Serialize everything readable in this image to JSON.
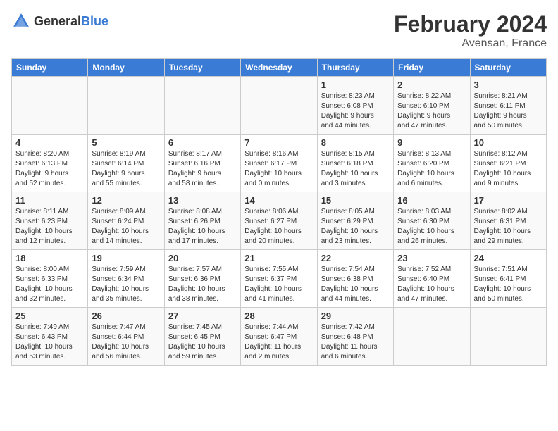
{
  "header": {
    "logo_general": "General",
    "logo_blue": "Blue",
    "month_year": "February 2024",
    "location": "Avensan, France"
  },
  "days_of_week": [
    "Sunday",
    "Monday",
    "Tuesday",
    "Wednesday",
    "Thursday",
    "Friday",
    "Saturday"
  ],
  "weeks": [
    [
      {
        "day": "",
        "info": ""
      },
      {
        "day": "",
        "info": ""
      },
      {
        "day": "",
        "info": ""
      },
      {
        "day": "",
        "info": ""
      },
      {
        "day": "1",
        "info": "Sunrise: 8:23 AM\nSunset: 6:08 PM\nDaylight: 9 hours\nand 44 minutes."
      },
      {
        "day": "2",
        "info": "Sunrise: 8:22 AM\nSunset: 6:10 PM\nDaylight: 9 hours\nand 47 minutes."
      },
      {
        "day": "3",
        "info": "Sunrise: 8:21 AM\nSunset: 6:11 PM\nDaylight: 9 hours\nand 50 minutes."
      }
    ],
    [
      {
        "day": "4",
        "info": "Sunrise: 8:20 AM\nSunset: 6:13 PM\nDaylight: 9 hours\nand 52 minutes."
      },
      {
        "day": "5",
        "info": "Sunrise: 8:19 AM\nSunset: 6:14 PM\nDaylight: 9 hours\nand 55 minutes."
      },
      {
        "day": "6",
        "info": "Sunrise: 8:17 AM\nSunset: 6:16 PM\nDaylight: 9 hours\nand 58 minutes."
      },
      {
        "day": "7",
        "info": "Sunrise: 8:16 AM\nSunset: 6:17 PM\nDaylight: 10 hours\nand 0 minutes."
      },
      {
        "day": "8",
        "info": "Sunrise: 8:15 AM\nSunset: 6:18 PM\nDaylight: 10 hours\nand 3 minutes."
      },
      {
        "day": "9",
        "info": "Sunrise: 8:13 AM\nSunset: 6:20 PM\nDaylight: 10 hours\nand 6 minutes."
      },
      {
        "day": "10",
        "info": "Sunrise: 8:12 AM\nSunset: 6:21 PM\nDaylight: 10 hours\nand 9 minutes."
      }
    ],
    [
      {
        "day": "11",
        "info": "Sunrise: 8:11 AM\nSunset: 6:23 PM\nDaylight: 10 hours\nand 12 minutes."
      },
      {
        "day": "12",
        "info": "Sunrise: 8:09 AM\nSunset: 6:24 PM\nDaylight: 10 hours\nand 14 minutes."
      },
      {
        "day": "13",
        "info": "Sunrise: 8:08 AM\nSunset: 6:26 PM\nDaylight: 10 hours\nand 17 minutes."
      },
      {
        "day": "14",
        "info": "Sunrise: 8:06 AM\nSunset: 6:27 PM\nDaylight: 10 hours\nand 20 minutes."
      },
      {
        "day": "15",
        "info": "Sunrise: 8:05 AM\nSunset: 6:29 PM\nDaylight: 10 hours\nand 23 minutes."
      },
      {
        "day": "16",
        "info": "Sunrise: 8:03 AM\nSunset: 6:30 PM\nDaylight: 10 hours\nand 26 minutes."
      },
      {
        "day": "17",
        "info": "Sunrise: 8:02 AM\nSunset: 6:31 PM\nDaylight: 10 hours\nand 29 minutes."
      }
    ],
    [
      {
        "day": "18",
        "info": "Sunrise: 8:00 AM\nSunset: 6:33 PM\nDaylight: 10 hours\nand 32 minutes."
      },
      {
        "day": "19",
        "info": "Sunrise: 7:59 AM\nSunset: 6:34 PM\nDaylight: 10 hours\nand 35 minutes."
      },
      {
        "day": "20",
        "info": "Sunrise: 7:57 AM\nSunset: 6:36 PM\nDaylight: 10 hours\nand 38 minutes."
      },
      {
        "day": "21",
        "info": "Sunrise: 7:55 AM\nSunset: 6:37 PM\nDaylight: 10 hours\nand 41 minutes."
      },
      {
        "day": "22",
        "info": "Sunrise: 7:54 AM\nSunset: 6:38 PM\nDaylight: 10 hours\nand 44 minutes."
      },
      {
        "day": "23",
        "info": "Sunrise: 7:52 AM\nSunset: 6:40 PM\nDaylight: 10 hours\nand 47 minutes."
      },
      {
        "day": "24",
        "info": "Sunrise: 7:51 AM\nSunset: 6:41 PM\nDaylight: 10 hours\nand 50 minutes."
      }
    ],
    [
      {
        "day": "25",
        "info": "Sunrise: 7:49 AM\nSunset: 6:43 PM\nDaylight: 10 hours\nand 53 minutes."
      },
      {
        "day": "26",
        "info": "Sunrise: 7:47 AM\nSunset: 6:44 PM\nDaylight: 10 hours\nand 56 minutes."
      },
      {
        "day": "27",
        "info": "Sunrise: 7:45 AM\nSunset: 6:45 PM\nDaylight: 10 hours\nand 59 minutes."
      },
      {
        "day": "28",
        "info": "Sunrise: 7:44 AM\nSunset: 6:47 PM\nDaylight: 11 hours\nand 2 minutes."
      },
      {
        "day": "29",
        "info": "Sunrise: 7:42 AM\nSunset: 6:48 PM\nDaylight: 11 hours\nand 6 minutes."
      },
      {
        "day": "",
        "info": ""
      },
      {
        "day": "",
        "info": ""
      }
    ]
  ]
}
